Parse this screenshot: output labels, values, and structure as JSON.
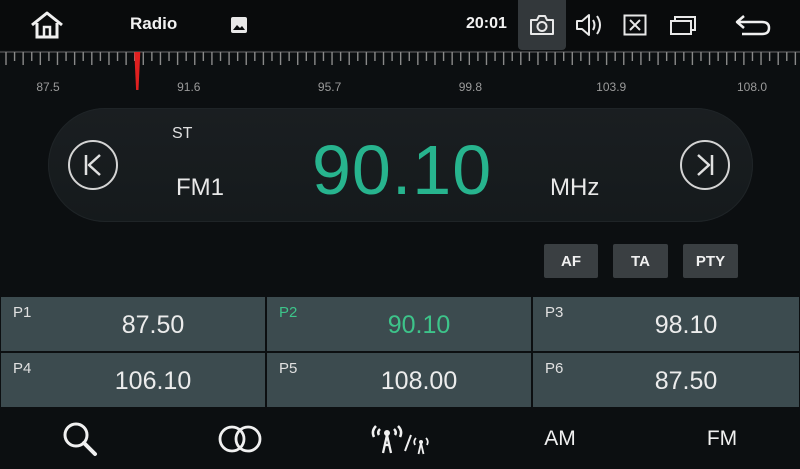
{
  "statusbar": {
    "title": "Radio",
    "time": "20:01",
    "icons": [
      "home-icon",
      "gallery-icon",
      "camera-icon",
      "volume-icon",
      "close-window-icon",
      "multi-window-icon",
      "back-icon"
    ]
  },
  "scale": {
    "labels": [
      "87.5",
      "91.6",
      "95.7",
      "99.8",
      "103.9",
      "108.0"
    ],
    "min_mhz": 87.5,
    "max_mhz": 108.0,
    "current_mhz": 90.1,
    "marker_color": "#e02020"
  },
  "tuner": {
    "stereo": "ST",
    "band": "FM1",
    "frequency": "90.10",
    "unit": "MHz",
    "frequency_color": "#27b48e"
  },
  "options": {
    "af": "AF",
    "ta": "TA",
    "pty": "PTY"
  },
  "presets": [
    {
      "label": "P1",
      "freq": "87.50",
      "active": false
    },
    {
      "label": "P2",
      "freq": "90.10",
      "active": true
    },
    {
      "label": "P3",
      "freq": "98.10",
      "active": false
    },
    {
      "label": "P4",
      "freq": "106.10",
      "active": false
    },
    {
      "label": "P5",
      "freq": "108.00",
      "active": false
    },
    {
      "label": "P6",
      "freq": "87.50",
      "active": false
    }
  ],
  "bottomnav": {
    "am": "AM",
    "fm": "FM",
    "icons": [
      "search-icon",
      "stereo-icon",
      "local-distance-icon"
    ]
  }
}
